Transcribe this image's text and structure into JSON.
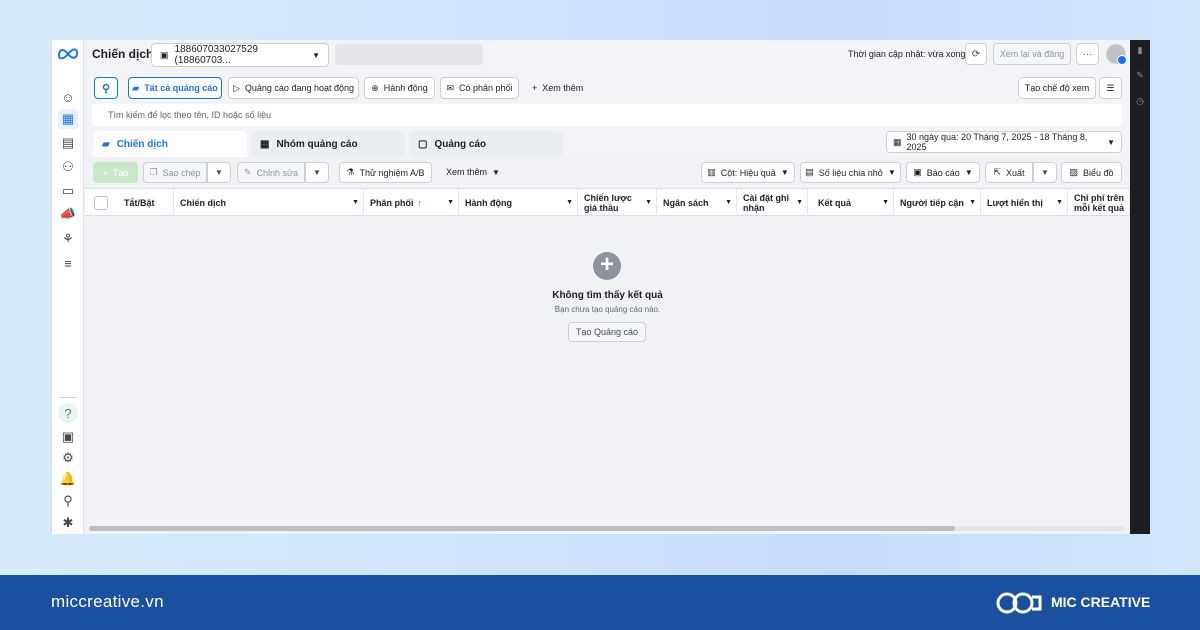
{
  "topbar": {
    "title": "Chiến dịch",
    "account": "188607033027529 (18860703...",
    "update_time": "Thời gian cập nhật: vừa xong",
    "review_publish": "Xem lại và đăng",
    "more": "···"
  },
  "filters": {
    "all_ads": "Tất cả quảng cáo",
    "active_ads": "Quảng cáo đang hoạt động",
    "actions": "Hành động",
    "delivery": "Có phân phối",
    "see_more": "Xem thêm",
    "create_view": "Tạo chế độ xem"
  },
  "search": {
    "placeholder": "Tìm kiếm để lọc theo tên, ID hoặc số liệu"
  },
  "tabs": [
    {
      "label": "Chiến dịch"
    },
    {
      "label": "Nhóm quảng cáo"
    },
    {
      "label": "Quảng cáo"
    }
  ],
  "date_range": "30 ngày qua: 20 Tháng 7, 2025 - 18 Tháng 8, 2025",
  "toolbar": {
    "create": "Tạo",
    "duplicate": "Sao chép",
    "edit": "Chỉnh sửa",
    "ab_test": "Thử nghiệm A/B",
    "see_more": "Xem thêm",
    "columns": "Cột: Hiệu quả",
    "breakdown": "Số liệu chia nhỏ",
    "reports": "Báo cáo",
    "export": "Xuất",
    "charts": "Biểu đồ"
  },
  "columns": [
    "Tắt/Bật",
    "Chiến dịch",
    "Phân phối",
    "Hành động",
    "Chiến lược giá thầu",
    "Ngân sách",
    "Cài đặt ghi nhận",
    "Kết quả",
    "Người tiếp cận",
    "Lượt hiển thị",
    "Chi phí trên mỗi kết quả"
  ],
  "empty_state": {
    "title": "Không tìm thấy kết quả",
    "subtitle": "Bạn chưa tạo quảng cáo nào.",
    "button": "Tạo Quảng cáo"
  },
  "footer": {
    "site": "miccreative.vn",
    "brand": "MIC CREATIVE"
  },
  "colors": {
    "accent": "#1b74e4",
    "footer": "#1b4fa0"
  }
}
